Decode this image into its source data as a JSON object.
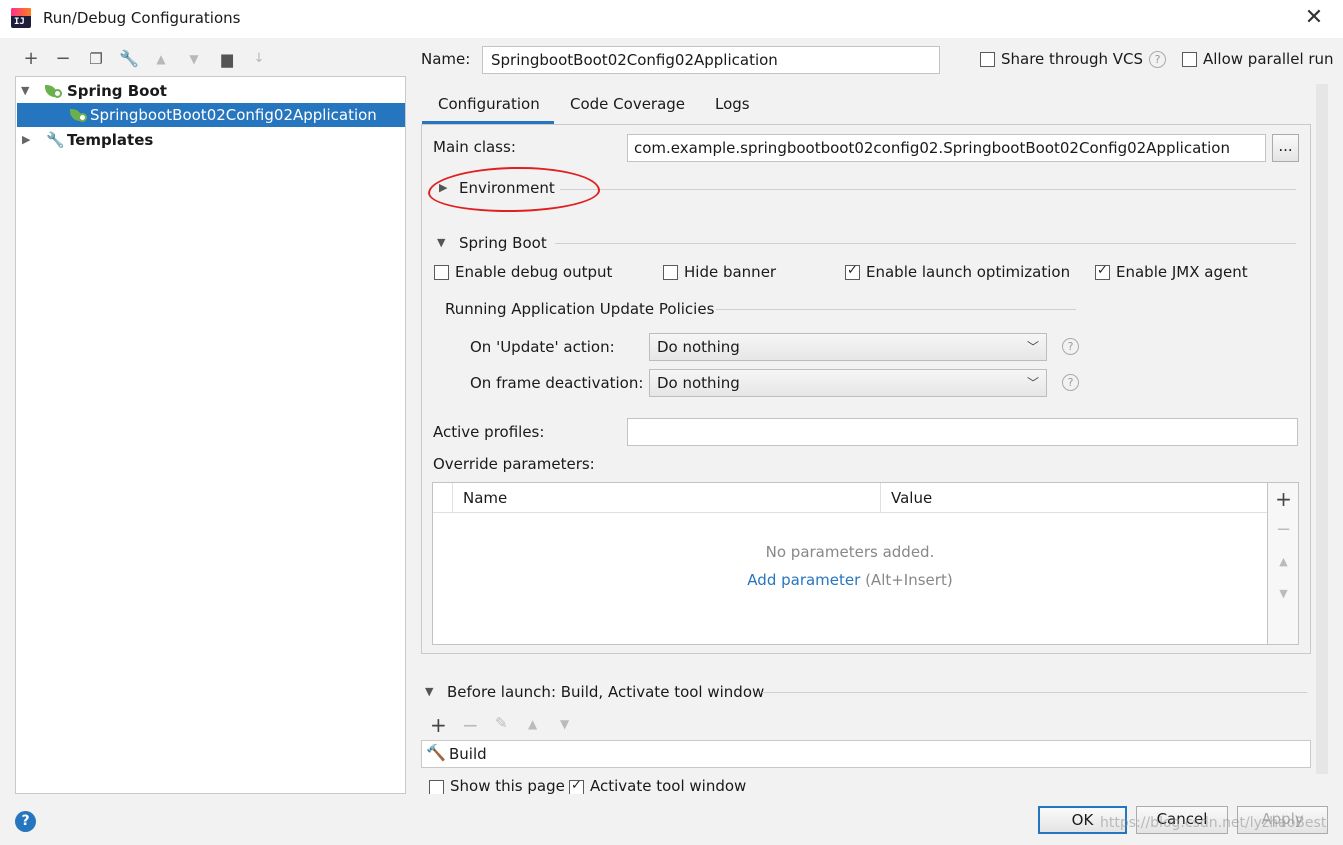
{
  "window": {
    "title": "Run/Debug Configurations"
  },
  "tree": {
    "items": [
      {
        "label": "Spring Boot",
        "expanded": true
      },
      {
        "label": "SpringbootBoot02Config02Application",
        "selected": true
      },
      {
        "label": "Templates",
        "expanded": false
      }
    ]
  },
  "header": {
    "name_label": "Name:",
    "name_value": "SpringbootBoot02Config02Application",
    "share_label": "Share through VCS",
    "parallel_label": "Allow parallel run",
    "help_glyph": "?"
  },
  "tabs": [
    {
      "label": "Configuration",
      "active": true
    },
    {
      "label": "Code Coverage"
    },
    {
      "label": "Logs"
    }
  ],
  "config": {
    "main_class_label": "Main class:",
    "main_class_value": "com.example.springbootboot02config02.SpringbootBoot02Config02Application",
    "browse_label": "...",
    "environment_label": "Environment",
    "spring_boot_label": "Spring Boot",
    "debug_output_label": "Enable debug output",
    "hide_banner_label": "Hide banner",
    "launch_opt_label": "Enable launch optimization",
    "jmx_label": "Enable JMX agent",
    "policies_label": "Running Application Update Policies",
    "on_update_label": "On 'Update' action:",
    "on_update_value": "Do nothing",
    "on_frame_label": "On frame deactivation:",
    "on_frame_value": "Do nothing",
    "active_profiles_label": "Active profiles:",
    "override_label": "Override parameters:",
    "table_col_name": "Name",
    "table_col_value": "Value",
    "empty_text": "No parameters added.",
    "add_param_link": "Add parameter",
    "add_param_hint": "(Alt+Insert)"
  },
  "before_launch": {
    "title": "Before launch: Build, Activate tool window",
    "build_label": "Build",
    "show_page_label": "Show this page",
    "activate_label": "Activate tool window"
  },
  "buttons": {
    "ok": "OK",
    "cancel": "Cancel",
    "apply": "Apply"
  },
  "watermark": "https://blog.csdn.net/lyzhaoBest",
  "colors": {
    "accent": "#2675bf",
    "annotation": "#e02020",
    "spring_green": "#6ab04c"
  }
}
